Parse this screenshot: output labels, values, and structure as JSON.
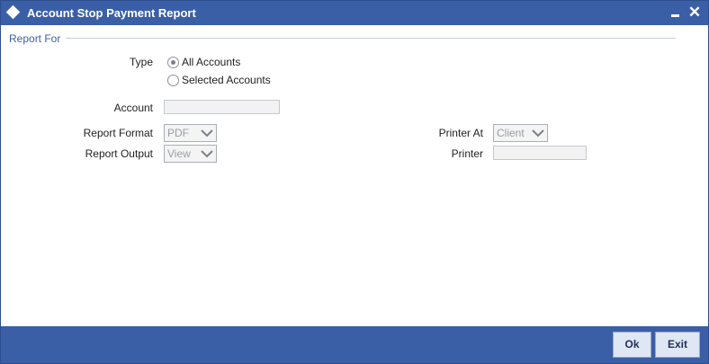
{
  "window": {
    "title": "Account Stop Payment Report",
    "minimize_label": "",
    "close_label": "✕"
  },
  "section": {
    "title": "Report For"
  },
  "type": {
    "label": "Type",
    "options": [
      {
        "label": "All Accounts",
        "checked": true
      },
      {
        "label": "Selected Accounts",
        "checked": false
      }
    ]
  },
  "account": {
    "label": "Account",
    "value": ""
  },
  "report_format": {
    "label": "Report Format",
    "value": "PDF"
  },
  "report_output": {
    "label": "Report Output",
    "value": "View"
  },
  "printer_at": {
    "label": "Printer At",
    "value": "Client"
  },
  "printer": {
    "label": "Printer",
    "value": ""
  },
  "footer": {
    "ok_label": "Ok",
    "exit_label": "Exit"
  },
  "colors": {
    "titlebar": "#3a5fa6",
    "section_title": "#3a5fa6",
    "button_bg": "#dfe6f4"
  }
}
